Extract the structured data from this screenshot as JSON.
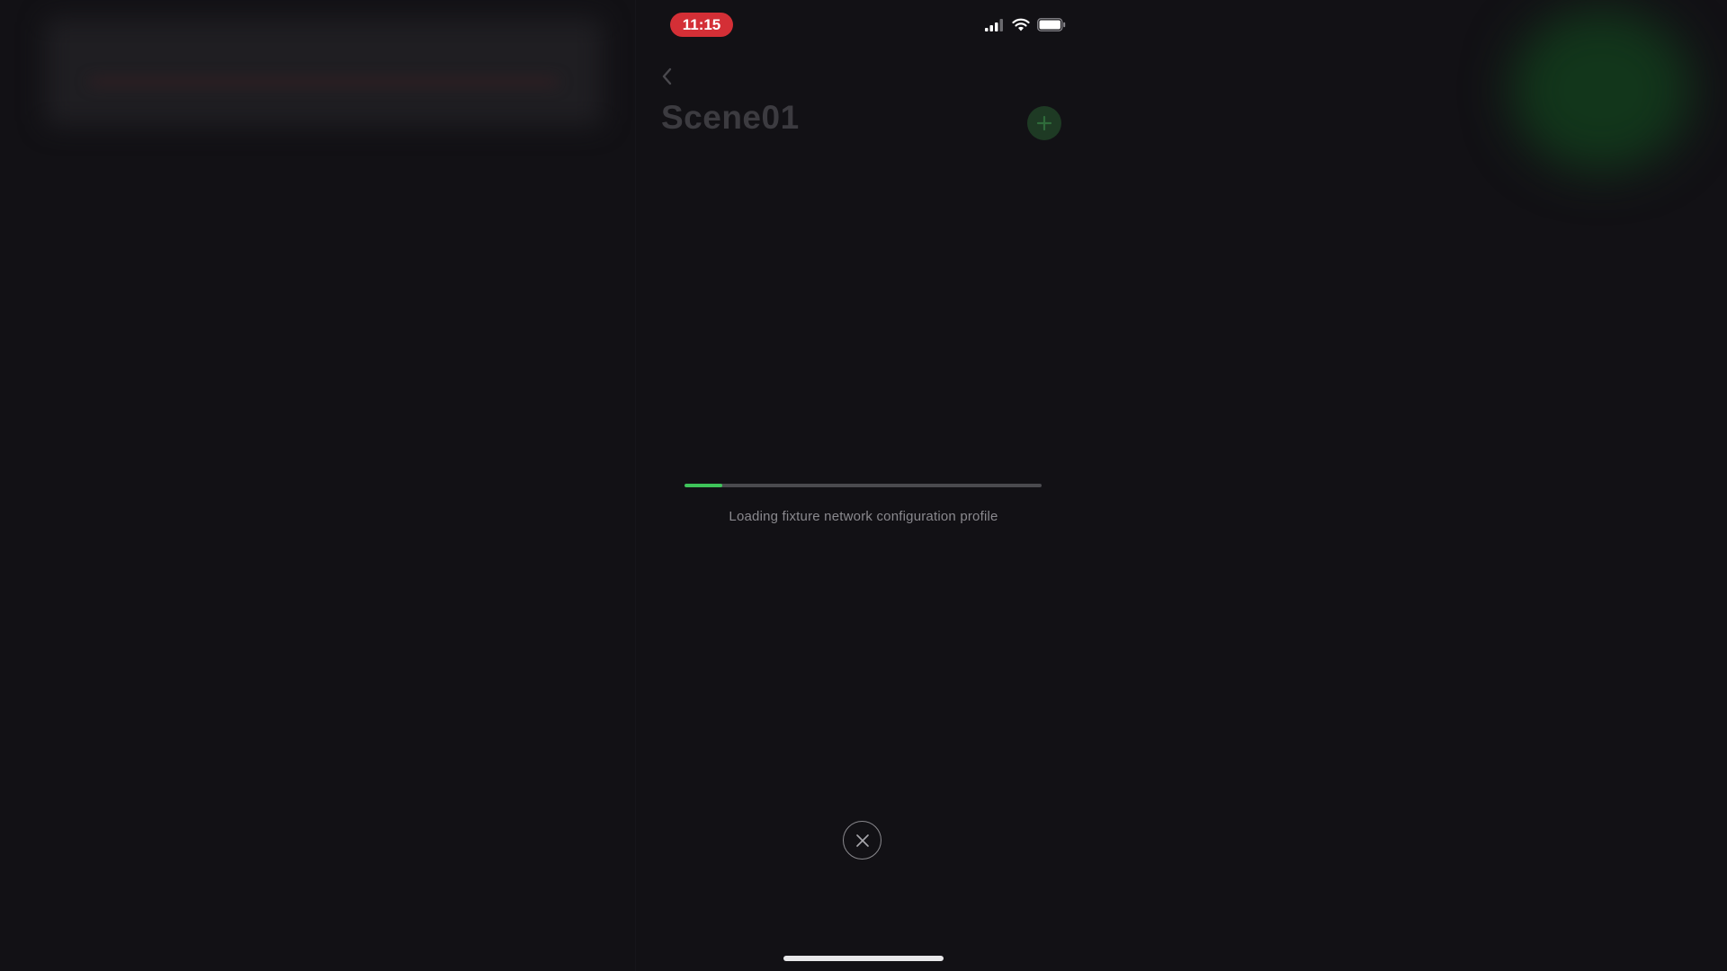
{
  "status_bar": {
    "time": "11:15",
    "icons": [
      "cellular-signal-icon",
      "wifi-icon",
      "battery-icon"
    ]
  },
  "header": {
    "title": "Scene01",
    "back_icon": "chevron-left-icon",
    "add_icon": "plus-icon"
  },
  "loading": {
    "progress_fraction": 0.105,
    "message": "Loading fixture network configuration profile"
  },
  "actions": {
    "close_icon": "close-icon"
  },
  "colors": {
    "background": "#121115",
    "time_pill": "#d42f36",
    "progress_fill": "#3ec45a",
    "progress_track": "#4a4a4e",
    "add_button": "#1e3a24"
  }
}
